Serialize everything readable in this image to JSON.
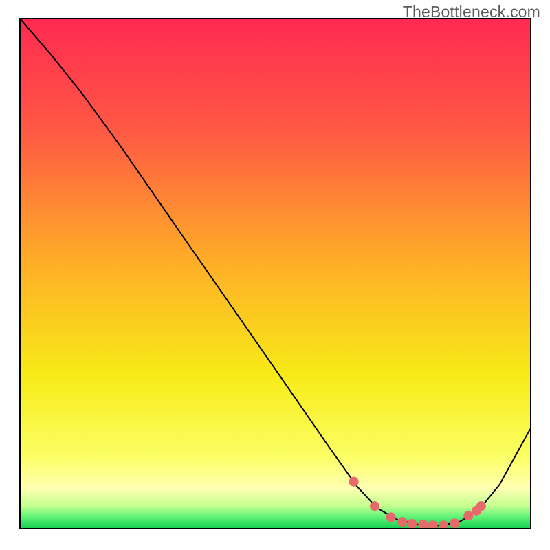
{
  "watermark": "TheBottleneck.com",
  "chart_data": {
    "type": "line",
    "title": "",
    "xlabel": "",
    "ylabel": "",
    "xlim": [
      0,
      100
    ],
    "ylim": [
      0,
      100
    ],
    "grid": false,
    "legend": false,
    "notes": "Axes have no tick labels. Values are normalized 0-100 in each dimension, estimated from pixel positions.",
    "series": [
      {
        "name": "main-curve",
        "color": "#000000",
        "x": [
          0,
          6,
          12,
          20,
          30,
          40,
          50,
          60,
          66,
          70,
          74,
          78,
          82,
          86,
          90,
          94,
          100
        ],
        "y": [
          100,
          93,
          85.5,
          74.5,
          60,
          45.6,
          31.2,
          16.7,
          8.2,
          3.9,
          1.6,
          0.7,
          0.5,
          1.1,
          3.6,
          8.5,
          19.4
        ]
      },
      {
        "name": "highlight-dots",
        "color": "#E76A6A",
        "x": [
          65.4,
          69.5,
          72.7,
          74.9,
          76.8,
          79.0,
          80.9,
          83.0,
          85.2,
          87.9,
          89.5,
          90.4
        ],
        "y": [
          9.1,
          4.3,
          2.1,
          1.2,
          0.8,
          0.7,
          0.5,
          0.5,
          0.9,
          2.4,
          3.4,
          4.3
        ]
      }
    ],
    "background_gradient": {
      "type": "vertical",
      "stops": [
        {
          "pos": 0,
          "color": "#FF2A51"
        },
        {
          "pos": 22,
          "color": "#FF5944"
        },
        {
          "pos": 47,
          "color": "#FFAC28"
        },
        {
          "pos": 70,
          "color": "#F7EB17"
        },
        {
          "pos": 86,
          "color": "#FCFF65"
        },
        {
          "pos": 92,
          "color": "#FFFFB2"
        },
        {
          "pos": 95.5,
          "color": "#C4FF8F"
        },
        {
          "pos": 97.5,
          "color": "#66F57A"
        },
        {
          "pos": 100,
          "color": "#12CE4E"
        }
      ]
    }
  }
}
